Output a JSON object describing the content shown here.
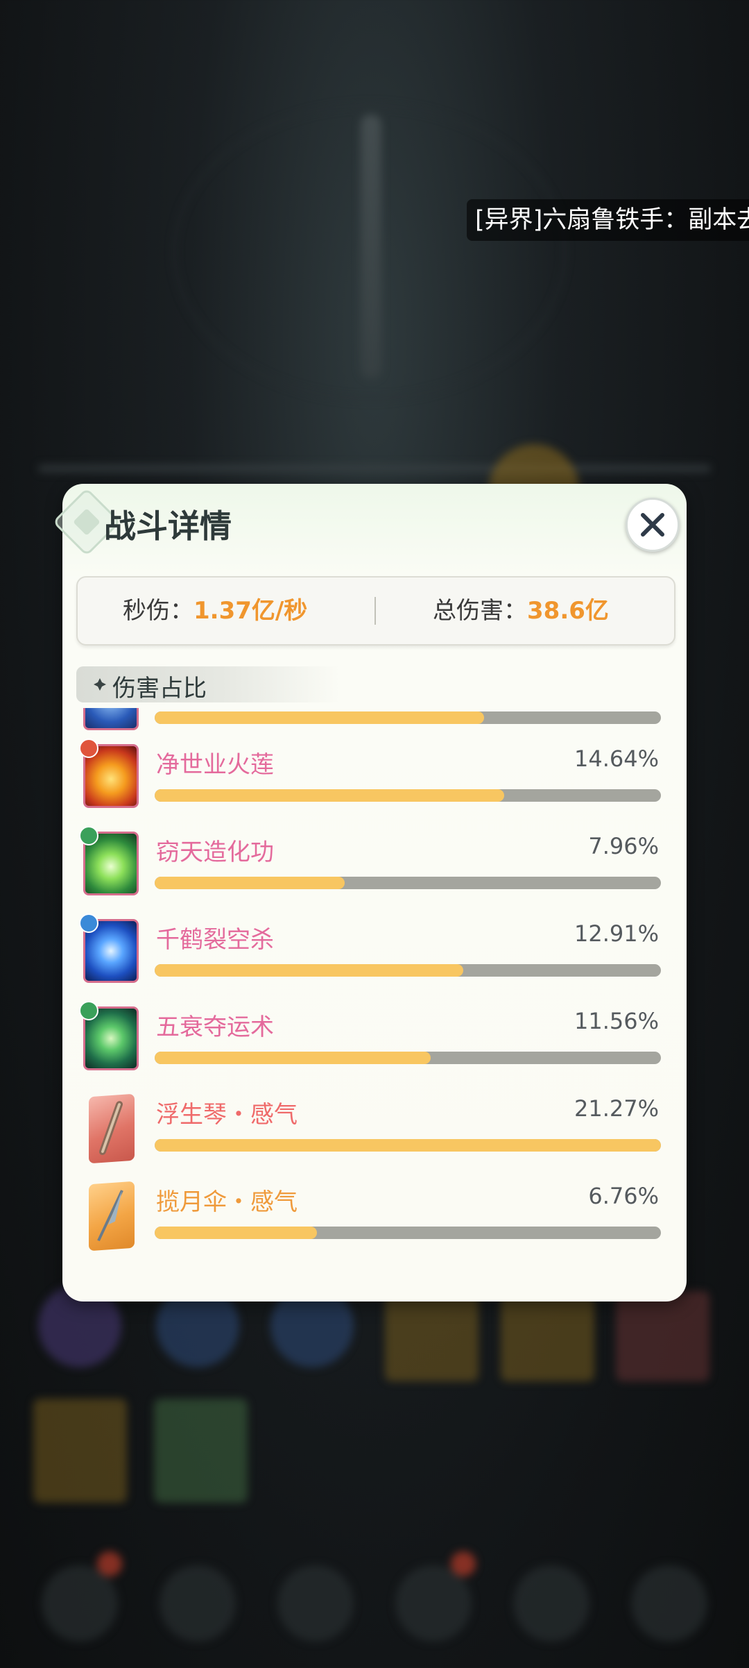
{
  "toast": "[异界]六扇鲁铁手：副本去",
  "dialog": {
    "title": "战斗详情",
    "stats": {
      "dps_label": "秒伤：",
      "dps_value": "1.37亿/秒",
      "total_label": "总伤害：",
      "total_value": "38.6亿"
    },
    "section_title": "伤害占比",
    "items": [
      {
        "name": "",
        "percent": "",
        "fill": 0.65,
        "icon": "blue-skill-icon",
        "partial": true
      },
      {
        "name": "净世业火莲",
        "percent": "14.64%",
        "fill": 0.69,
        "icon": "fire-lotus-icon",
        "badge": "fire-element-badge",
        "name_color": "#e46a9c"
      },
      {
        "name": "窃天造化功",
        "percent": "7.96%",
        "fill": 0.375,
        "icon": "green-glow-skill-icon",
        "badge": "wood-element-badge",
        "name_color": "#e46a9c"
      },
      {
        "name": "千鹤裂空杀",
        "percent": "12.91%",
        "fill": 0.61,
        "icon": "crossed-swords-skill-icon",
        "badge": "water-element-badge",
        "name_color": "#e46a9c"
      },
      {
        "name": "五衰夺运术",
        "percent": "11.56%",
        "fill": 0.545,
        "icon": "green-rune-skill-icon",
        "badge": "wood-element-badge",
        "name_color": "#e46a9c"
      },
      {
        "name": "浮生琴・感气",
        "percent": "21.27%",
        "fill": 1.0,
        "icon": "zither-item-icon",
        "name_color": "#ef6a6a"
      },
      {
        "name": "揽月伞・感气",
        "percent": "6.76%",
        "fill": 0.32,
        "icon": "umbrella-item-icon",
        "name_color": "#ef9a3b"
      }
    ]
  }
}
